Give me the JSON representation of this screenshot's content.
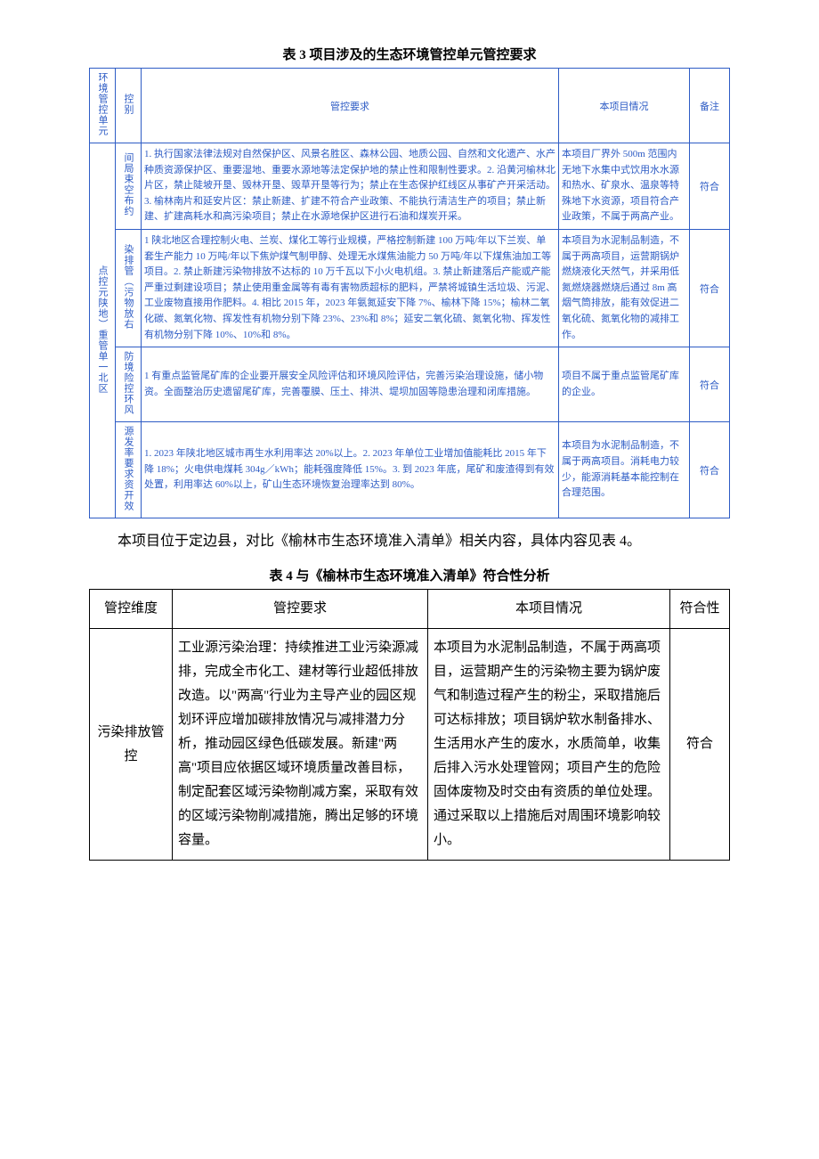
{
  "table3": {
    "title": "表 3 项目涉及的生态环境管控单元管控要求",
    "headers": {
      "unit": "环境管控单元",
      "category": "控别",
      "requirement": "管控要求",
      "situation": "本项目情况",
      "remark": "备注"
    },
    "unit_label": "点控元陕地︶重管单一北区",
    "rows": [
      {
        "category": "间局束空布约",
        "requirement": "1. 执行国家法律法规对自然保护区、风景名胜区、森林公园、地质公园、自然和文化遗产、水产种质资源保护区、重要湿地、重要水源地等法定保护地的禁止性和限制性要求。2. 沿黄河榆林北片区，禁止陡坡开垦、毁林开垦、毁草开垦等行为；禁止在生态保护红线区从事矿产开采活动。3. 榆林南片和延安片区：禁止新建、扩建不符合产业政策、不能执行清洁生产的项目；禁止新建、扩建高耗水和高污染项目；禁止在水源地保护区进行石油和煤炭开采。",
        "situation": "本项目厂界外 500m 范围内无地下水集中式饮用水水源和热水、矿泉水、温泉等特殊地下水资源，项目符合产业政策，不属于两高产业。",
        "remark": "符合"
      },
      {
        "category": "染排管︵污物放右",
        "requirement": "1 陕北地区合理控制火电、兰炭、煤化工等行业规模，严格控制新建 100 万吨/年以下兰炭、单套生产能力 10 万吨/年以下焦炉煤气制甲醇、处理无水煤焦油能力 50 万吨/年以下煤焦油加工等项目。2. 禁止新建污染物排放不达标的 10 万千瓦以下小火电机组。3. 禁止新建落后产能或产能严重过剩建设项目；禁止使用重金属等有毒有害物质超标的肥料，严禁将城镇生活垃圾、污泥、工业废物直接用作肥料。4. 相比 2015 年，2023 年氨氮延安下降 7%、榆林下降 15%；榆林二氧化碳、氮氧化物、挥发性有机物分别下降 23%、23%和 8%；延安二氧化硫、氮氧化物、挥发性有机物分别下降 10%、10%和 8%。",
        "situation": "本项目为水泥制品制造，不属于两高项目，运营期锅炉燃烧液化天然气，并采用低氮燃烧器燃烧后通过 8m 高烟气筒排放，能有效促进二氧化硫、氮氧化物的减排工作。",
        "remark": "符合"
      },
      {
        "category": "防境险控环风",
        "requirement": "1 有重点监管尾矿库的企业要开展安全风险评估和环境风险评估，完善污染治理设施，储小物资。全面整治历史遗留尾矿库，完善覆膜、压土、排洪、堤坝加固等隐患治理和闭库措施。",
        "situation": "项目不属于重点监管尾矿库的企业。",
        "remark": "符合"
      },
      {
        "category": "源发率要求资开效",
        "requirement": "1. 2023 年陕北地区城市再生水利用率达 20%以上。2. 2023 年单位工业增加值能耗比 2015 年下降 18%；火电供电煤耗 304g／kWh；能耗强度降低 15%。3. 到 2023 年底，尾矿和废渣得到有效处置，利用率达 60%以上，矿山生态环境恢复治理率达到 80%。",
        "situation": "本项目为水泥制品制造，不属于两高项目。消耗电力较少，能源消耗基本能控制在合理范围。",
        "remark": "符合"
      }
    ]
  },
  "paragraph": "本项目位于定边县，对比《榆林市生态环境准入清单》相关内容，具体内容见表 4。",
  "table4": {
    "title": "表 4 与《榆林市生态环境准入清单》符合性分析",
    "headers": {
      "dimension": "管控维度",
      "requirement": "管控要求",
      "situation": "本项目情况",
      "conformity": "符合性"
    },
    "rows": [
      {
        "dimension": "污染排放管控",
        "requirement": "工业源污染治理：持续推进工业污染源减排，完成全市化工、建材等行业超低排放改造。以\"两高\"行业为主导产业的园区规划环评应增加碳排放情况与减排潜力分析，推动园区绿色低碳发展。新建\"两高\"项目应依据区域环境质量改善目标，制定配套区域污染物削减方案，采取有效的区域污染物削减措施，腾出足够的环境容量。",
        "situation": "本项目为水泥制品制造，不属于两高项目，运营期产生的污染物主要为锅炉废气和制造过程产生的粉尘，采取措施后可达标排放；项目锅炉软水制备排水、生活用水产生的废水，水质简单，收集后排入污水处理管网；项目产生的危险固体废物及时交由有资质的单位处理。通过采取以上措施后对周围环境影响较小。",
        "conformity": "符合"
      }
    ]
  }
}
